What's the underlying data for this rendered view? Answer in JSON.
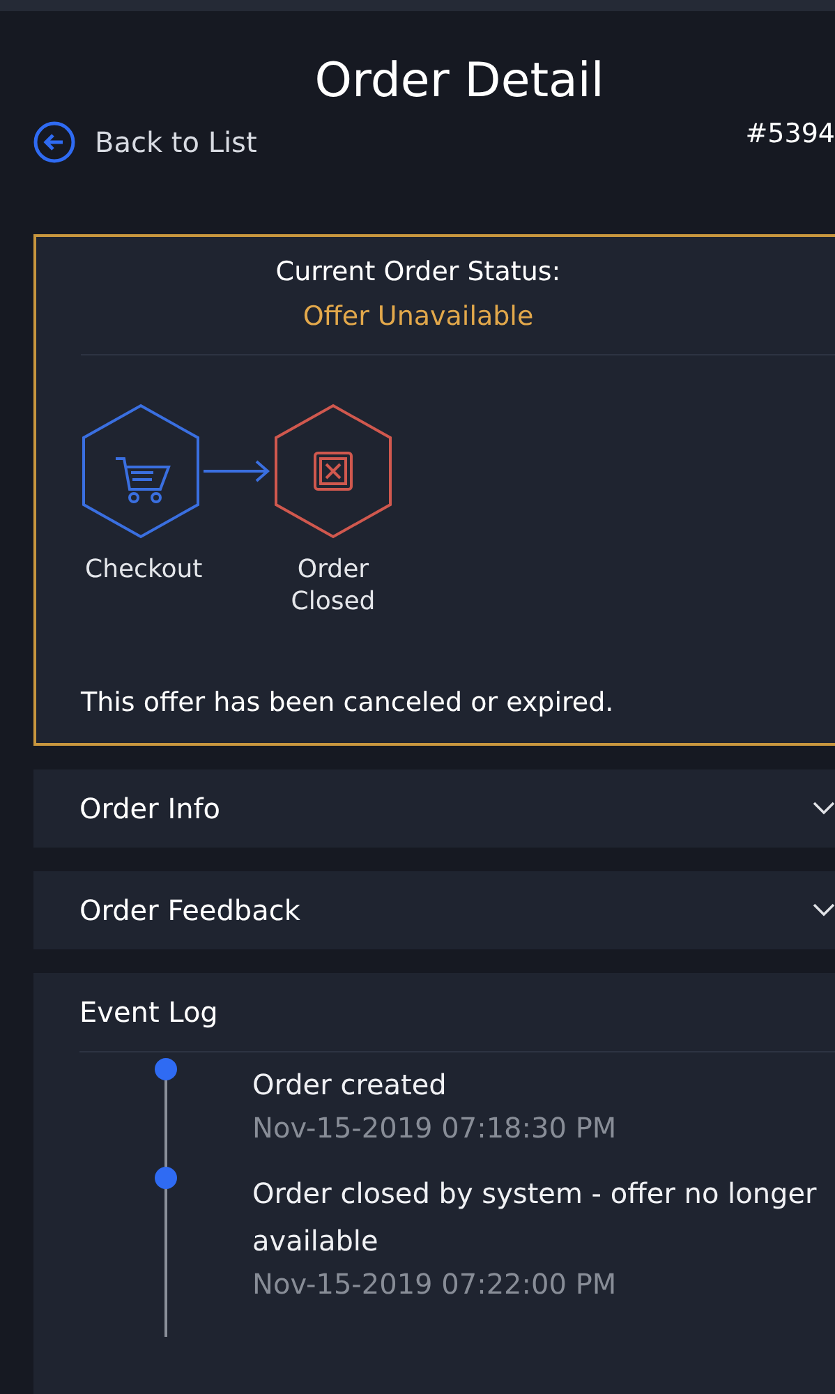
{
  "header": {
    "title": "Order Detail",
    "back_link": "Back to List",
    "order_number": "#5394"
  },
  "status_card": {
    "heading": "Current Order Status:",
    "status": "Offer Unavailable",
    "steps": [
      {
        "label": "Checkout",
        "kind": "cart",
        "color": "#3a6fe0"
      },
      {
        "label": "Order Closed",
        "kind": "closed",
        "color": "#d0584e"
      }
    ],
    "message": "This offer has been canceled or expired."
  },
  "sections": [
    {
      "title": "Order Info",
      "expanded": false
    },
    {
      "title": "Order Feedback",
      "expanded": false
    },
    {
      "title": "Event Log",
      "expanded": true,
      "events": [
        {
          "text": "Order created",
          "time": "Nov-15-2019 07:18:30 PM"
        },
        {
          "text": "Order closed by system - offer no longer available",
          "time": "Nov-15-2019 07:22:00 PM"
        }
      ]
    }
  ]
}
